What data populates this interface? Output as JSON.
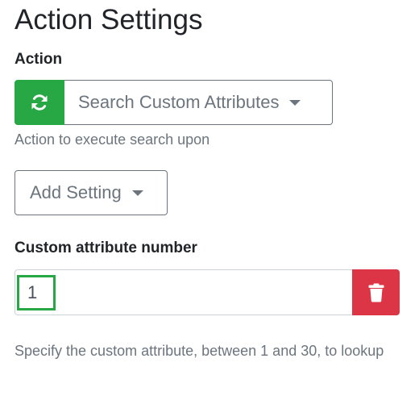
{
  "page": {
    "title": "Action Settings"
  },
  "action": {
    "label": "Action",
    "refresh_icon": "refresh-icon",
    "selected": "Search Custom Attributes",
    "help": "Action to execute search upon"
  },
  "add_setting": {
    "label": "Add Setting"
  },
  "custom_attribute": {
    "label": "Custom attribute number",
    "value": "1",
    "delete_icon": "trash-icon",
    "help": "Specify the custom attribute, between 1 and 30, to lookup"
  },
  "colors": {
    "success": "#28a745",
    "danger": "#dc3545",
    "muted": "#6c757d"
  }
}
